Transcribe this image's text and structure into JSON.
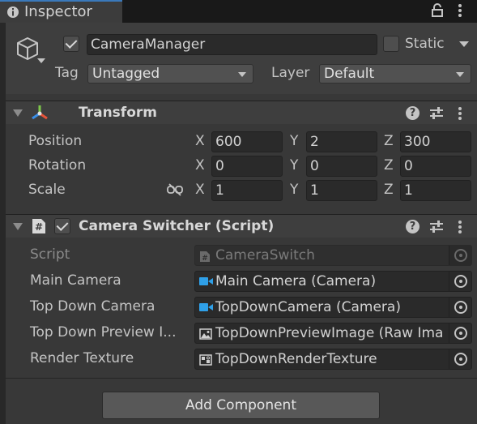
{
  "tab": {
    "title": "Inspector",
    "icon": "info-icon"
  },
  "header": {
    "icon": "cube-icon",
    "active_checked": true,
    "object_name": "CameraManager",
    "static_label": "Static",
    "static_checked": false,
    "tag_label": "Tag",
    "tag_value": "Untagged",
    "layer_label": "Layer",
    "layer_value": "Default"
  },
  "transform": {
    "title": "Transform",
    "icon": "transform-gizmo-icon",
    "rows": [
      {
        "label": "Position",
        "x": "600",
        "y": "2",
        "z": "300"
      },
      {
        "label": "Rotation",
        "x": "0",
        "y": "0",
        "z": "0"
      },
      {
        "label": "Scale",
        "x": "1",
        "y": "1",
        "z": "1"
      }
    ],
    "axis_labels": {
      "x": "X",
      "y": "Y",
      "z": "Z"
    }
  },
  "camera_switcher": {
    "title": "Camera Switcher (Script)",
    "icon": "script-hash-icon",
    "enabled": true,
    "fields": [
      {
        "label": "Script",
        "value": "CameraSwitch",
        "icon": "script-hash-icon",
        "disabled": true
      },
      {
        "label": "Main Camera",
        "value": "Main Camera (Camera)",
        "icon": "camera-icon",
        "disabled": false
      },
      {
        "label": "Top Down Camera",
        "value": "TopDownCamera (Camera)",
        "icon": "camera-icon",
        "disabled": false
      },
      {
        "label": "Top Down Preview I...",
        "value": "TopDownPreviewImage (Raw Ima",
        "icon": "raw-image-icon",
        "disabled": false
      },
      {
        "label": "Render Texture",
        "value": "TopDownRenderTexture",
        "icon": "render-texture-icon",
        "disabled": false
      }
    ]
  },
  "add_component_label": "Add Component",
  "colors": {
    "accent": "#3a79bb",
    "panel": "#383838",
    "header": "#3e3e3e",
    "field": "#2a2a2a"
  }
}
